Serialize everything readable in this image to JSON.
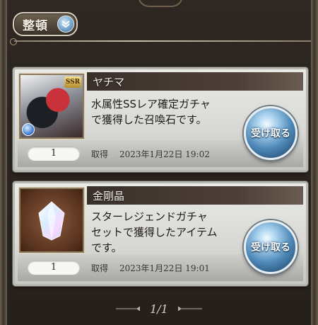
{
  "sort": {
    "label": "整頓",
    "icon": "chevron-down-icon"
  },
  "items": [
    {
      "title": "ヤチマ",
      "description": "水属性SSレア確定ガチャ\nで獲得した召喚石です。",
      "thumbnail_icon": "summon-character-thumbnail",
      "rarity": "SSR",
      "element_icon": "water-element-icon",
      "quantity": "1",
      "acquired_label": "取得",
      "acquired_date": "2023年1月22日 19:02",
      "receive_label": "受け取る"
    },
    {
      "title": "金剛晶",
      "description": "スターレジェンドガチャ\nセットで獲得したアイテム\nです。",
      "thumbnail_icon": "crystal-icon",
      "quantity": "1",
      "acquired_label": "取得",
      "acquired_date": "2023年1月22日 19:01",
      "receive_label": "受け取る"
    }
  ],
  "pagination": {
    "label": "1/1"
  },
  "colors": {
    "background": "#2a241f",
    "card": "#e0e0dc",
    "title_bar": "#3a302a",
    "receive_button": "#4f89b8"
  }
}
